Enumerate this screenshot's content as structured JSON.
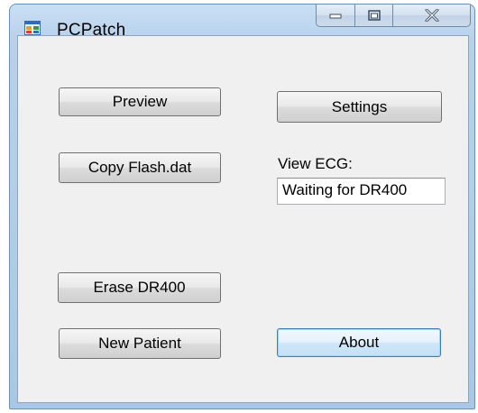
{
  "window": {
    "title": "PCPatch",
    "icon": "application-icon"
  },
  "caption_buttons": {
    "minimize_icon": "minimize-icon",
    "maximize_icon": "maximize-icon",
    "close_icon": "close-icon"
  },
  "buttons": {
    "preview": "Preview",
    "settings": "Settings",
    "copy_flash": "Copy Flash.dat",
    "erase": "Erase DR400",
    "new_patient": "New Patient",
    "about": "About"
  },
  "view_ecg": {
    "label": "View ECG:",
    "value": "Waiting for DR400"
  },
  "colors": {
    "titlebar": "#b7d1ec",
    "client_background": "#f0f0f0",
    "default_button_border": "#3c7fb1"
  }
}
